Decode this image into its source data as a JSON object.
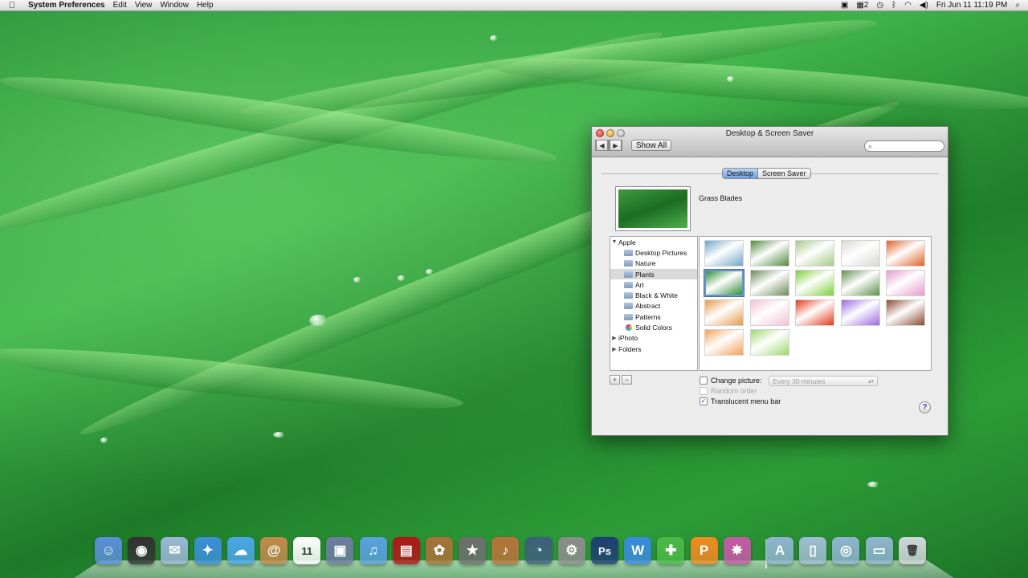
{
  "menubar": {
    "app_name": "System Preferences",
    "items": [
      "Edit",
      "View",
      "Window",
      "Help"
    ],
    "status": {
      "spaces": "2",
      "datetime": "Fri Jun 11  11:19 PM"
    }
  },
  "window": {
    "title": "Desktop & Screen Saver",
    "show_all": "Show All",
    "search_placeholder": "",
    "tabs": [
      "Desktop",
      "Screen Saver"
    ],
    "selected_tab": "Desktop",
    "current_picture": "Grass Blades",
    "sidebar": [
      {
        "label": "Apple",
        "kind": "group-open"
      },
      {
        "label": "Desktop Pictures",
        "kind": "folder"
      },
      {
        "label": "Nature",
        "kind": "folder"
      },
      {
        "label": "Plants",
        "kind": "folder",
        "selected": true
      },
      {
        "label": "Art",
        "kind": "folder"
      },
      {
        "label": "Black & White",
        "kind": "folder"
      },
      {
        "label": "Abstract",
        "kind": "folder"
      },
      {
        "label": "Patterns",
        "kind": "folder"
      },
      {
        "label": "Solid Colors",
        "kind": "colors"
      },
      {
        "label": "iPhoto",
        "kind": "group-closed"
      },
      {
        "label": "Folders",
        "kind": "group-closed"
      }
    ],
    "add_button": "+",
    "remove_button": "−",
    "change_picture_label": "Change picture:",
    "change_picture_interval": "Every 30 minutes",
    "random_order_label": "Random order",
    "translucent_label": "Translucent menu bar",
    "help": "?"
  },
  "thumb_colors": [
    [
      "#6fa6c9",
      "#4f8a3a",
      "#a7c98a",
      "#d8d8d0",
      "#e0602a"
    ],
    [
      "#2f8f3a",
      "#6d8a5a",
      "#7ccf3a",
      "#5e8f4e",
      "#e49ac8"
    ],
    [
      "#e79a4c",
      "#f2c2d2",
      "#e3381a",
      "#9b6ae0",
      "#8a4a30"
    ],
    [
      "#f2a15a",
      "#9ed86f"
    ]
  ],
  "dock": [
    {
      "name": "finder-icon",
      "color": "#5b8fd8",
      "glyph": "☺"
    },
    {
      "name": "dashboard-icon",
      "color": "#333333",
      "glyph": "◉"
    },
    {
      "name": "mail-icon",
      "color": "#9bb7d6",
      "glyph": "✉"
    },
    {
      "name": "safari-icon",
      "color": "#3a8fd8",
      "glyph": "✦"
    },
    {
      "name": "ichat-icon",
      "color": "#4aa6e8",
      "glyph": "☁"
    },
    {
      "name": "address-book-icon",
      "color": "#c28a4a",
      "glyph": "@"
    },
    {
      "name": "ical-icon",
      "color": "#ffffff",
      "glyph": "11"
    },
    {
      "name": "preview-icon",
      "color": "#6d7da0",
      "glyph": "▣"
    },
    {
      "name": "itunes-icon",
      "color": "#5aa0e0",
      "glyph": "♫"
    },
    {
      "name": "front-row-icon",
      "color": "#b01818",
      "glyph": "▤"
    },
    {
      "name": "iphoto-icon",
      "color": "#a87238",
      "glyph": "✿"
    },
    {
      "name": "imovie-icon",
      "color": "#6e6e6e",
      "glyph": "★"
    },
    {
      "name": "garageband-icon",
      "color": "#b8733a",
      "glyph": "♪"
    },
    {
      "name": "time-machine-icon",
      "color": "#3e5f7c",
      "glyph": "◔"
    },
    {
      "name": "system-preferences-icon",
      "color": "#8c8c8c",
      "glyph": "⚙"
    },
    {
      "name": "photoshop-icon",
      "color": "#1e3f72",
      "glyph": "Ps"
    },
    {
      "name": "iweb-icon",
      "color": "#3a8ae0",
      "glyph": "W"
    },
    {
      "name": "numbers-icon",
      "color": "#4cb849",
      "glyph": "✚"
    },
    {
      "name": "pages-icon",
      "color": "#f08a22",
      "glyph": "P"
    },
    {
      "name": "iphoto-slideshow-icon",
      "color": "#c65aa8",
      "glyph": "✸"
    },
    {
      "name": "applications-stack-icon",
      "color": "#8fb4cf",
      "glyph": "A"
    },
    {
      "name": "documents-stack-icon",
      "color": "#9fbcd2",
      "glyph": "▯"
    },
    {
      "name": "downloads-stack-icon",
      "color": "#8fb4cf",
      "glyph": "◎"
    },
    {
      "name": "folder-stack-icon",
      "color": "#8fb4cf",
      "glyph": "▭"
    },
    {
      "name": "trash-icon",
      "color": "#cfd6da",
      "glyph": "🗑"
    }
  ]
}
